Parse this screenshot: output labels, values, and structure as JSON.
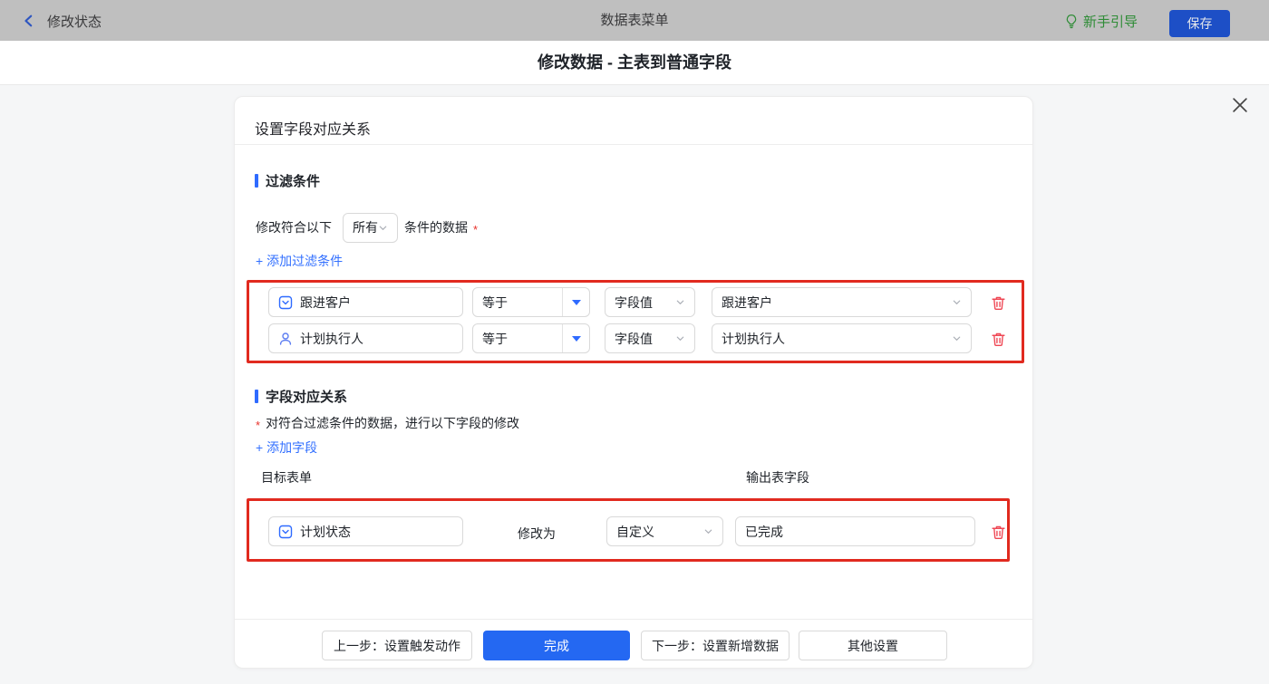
{
  "topbar": {
    "back_label": "修改状态",
    "title": "数据表菜单",
    "guide_label": "新手引导",
    "save_label": "保存"
  },
  "dialog": {
    "title": "修改数据 - 主表到普通字段",
    "close_icon": "x-icon",
    "card_title": "设置字段对应关系"
  },
  "filter_section": {
    "title": "过滤条件",
    "prefix": "修改符合以下",
    "match_select_value": "所有",
    "suffix": "条件的数据",
    "required_mark": "*",
    "add_link": "+ 添加过滤条件",
    "rows": [
      {
        "field": "跟进客户",
        "field_icon": "select-field-icon",
        "operator": "等于",
        "value_type": "字段值",
        "value": "跟进客户"
      },
      {
        "field": "计划执行人",
        "field_icon": "person-icon",
        "operator": "等于",
        "value_type": "字段值",
        "value": "计划执行人"
      }
    ]
  },
  "mapping_section": {
    "title": "字段对应关系",
    "required_mark": "*",
    "description": "对符合过滤条件的数据，进行以下字段的修改",
    "add_link": "+ 添加字段",
    "col_target": "目标表单",
    "col_output": "输出表字段",
    "rows": [
      {
        "field": "计划状态",
        "field_icon": "select-field-icon",
        "middle_label": "修改为",
        "mode_select_value": "自定义",
        "value": "已完成"
      }
    ]
  },
  "footer": {
    "prev_label": "上一步：设置触发动作",
    "done_label": "完成",
    "next_label": "下一步：设置新增数据",
    "other_label": "其他设置"
  },
  "colors": {
    "accent_blue": "#2468f2",
    "link_blue": "#3370ff",
    "section_bar_blue": "#2f6bff",
    "annotation_red": "#e12a1f",
    "trash_red": "#ef4653",
    "guide_green": "#2e8c36",
    "topbar_dim_gray": "#bfbfbf"
  }
}
